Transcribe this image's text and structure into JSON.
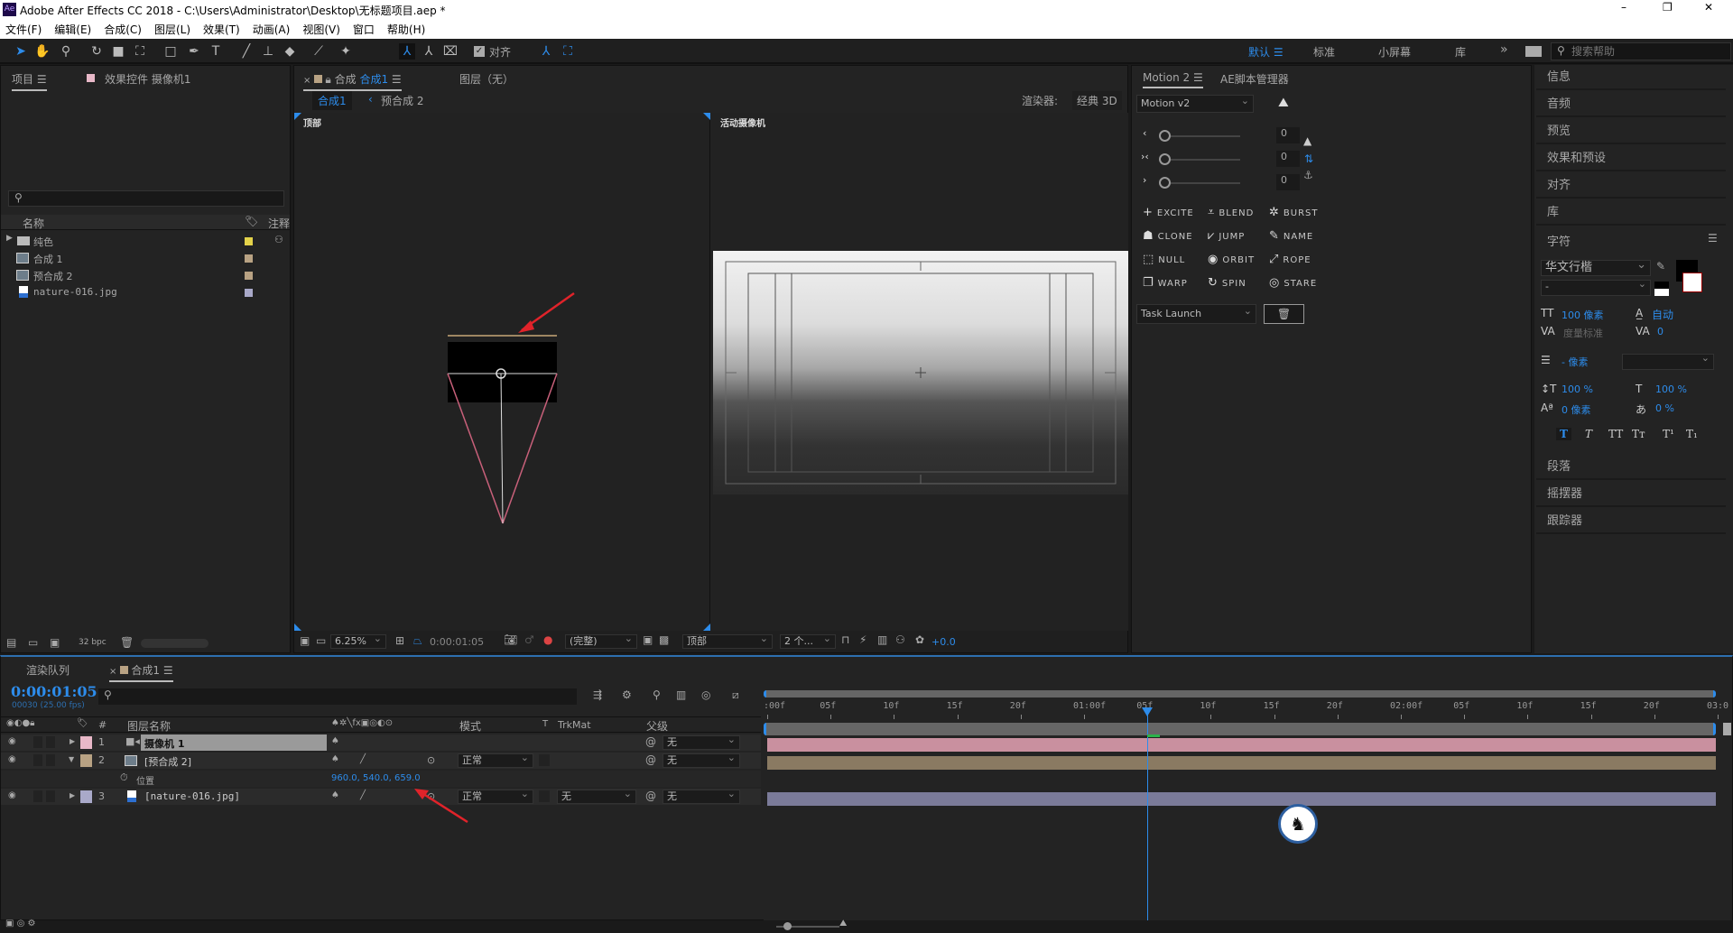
{
  "app": {
    "title": "Adobe After Effects CC 2018 - C:\\Users\\Administrator\\Desktop\\无标题项目.aep *",
    "logo": "Ae"
  },
  "window_controls": {
    "minimize": "–",
    "restore": "❐",
    "close": "✕"
  },
  "menu": [
    "文件(F)",
    "编辑(E)",
    "合成(C)",
    "图层(L)",
    "效果(T)",
    "动画(A)",
    "视图(V)",
    "窗口",
    "帮助(H)"
  ],
  "toolbar": {
    "snap_label": "对齐",
    "workspaces": [
      "默认",
      "标准",
      "小屏幕",
      "库"
    ],
    "more": "»",
    "search_placeholder": "搜索帮助"
  },
  "project": {
    "tab": "项目",
    "effects_tab": "效果控件 摄像机1",
    "search_placeholder": "",
    "col_name": "名称",
    "col_comment": "注释",
    "items": [
      {
        "name": "纯色",
        "type": "folder",
        "color": "#e3d24a"
      },
      {
        "name": "合成 1",
        "type": "comp",
        "color": "#b8a283"
      },
      {
        "name": "预合成 2",
        "type": "comp",
        "color": "#b8a283"
      },
      {
        "name": "nature-016.jpg",
        "type": "image",
        "color": "#a9a9c9"
      }
    ],
    "bpc": "32 bpc"
  },
  "composition": {
    "tab_prefix": "合成",
    "tab_name": "合成1",
    "layer_tab": "图层（无）",
    "breadcrumb": [
      "合成1",
      "预合成 2"
    ],
    "renderer_label": "渲染器:",
    "renderer": "经典 3D",
    "view_left_label": "顶部",
    "view_right_label": "活动摄像机",
    "footer": {
      "zoom": "6.25%",
      "timecode": "0:00:01:05",
      "resolution": "(完整)",
      "view": "顶部",
      "views": "2 个...",
      "exposure": "+0.0"
    }
  },
  "motion": {
    "tab": "Motion 2",
    "tab2": "AE脚本管理器",
    "preset": "Motion v2",
    "sliders": [
      {
        "icon": "‹",
        "value": "0"
      },
      {
        "icon": "›‹",
        "value": "0"
      },
      {
        "icon": "›",
        "value": "0"
      }
    ],
    "buttons": [
      {
        "label": "EXCITE",
        "icon": "+"
      },
      {
        "label": "BLEND",
        "icon": "⩡"
      },
      {
        "label": "BURST",
        "icon": "✲"
      },
      {
        "label": "CLONE",
        "icon": "☗"
      },
      {
        "label": "JUMP",
        "icon": "⩗"
      },
      {
        "label": "NAME",
        "icon": "✎"
      },
      {
        "label": "NULL",
        "icon": "⬚"
      },
      {
        "label": "ORBIT",
        "icon": "◉"
      },
      {
        "label": "ROPE",
        "icon": "⤢"
      },
      {
        "label": "WARP",
        "icon": "❐"
      },
      {
        "label": "SPIN",
        "icon": "↻"
      },
      {
        "label": "STARE",
        "icon": "◎"
      }
    ],
    "task": "Task Launch"
  },
  "right_panels": [
    "信息",
    "音频",
    "预览",
    "效果和预设",
    "对齐",
    "库"
  ],
  "character": {
    "title": "字符",
    "font": "华文行楷",
    "style": "-",
    "size": "100 像素",
    "leading": "自动",
    "kerning": "度量标准",
    "tracking": "0",
    "stroke": "- 像素",
    "vscale": "100 %",
    "hscale": "100 %",
    "baseline": "0 像素",
    "tsume": "0 %",
    "styles": [
      "T",
      "T",
      "TT",
      "Tт",
      "T¹",
      "T₁"
    ]
  },
  "more_panels": [
    "段落",
    "摇摆器",
    "跟踪器"
  ],
  "timeline": {
    "tab_render": "渲染队列",
    "tab_comp": "合成1",
    "timecode": "0:00:01:05",
    "frame_info": "00030 (25.00 fps)",
    "headers": {
      "num": "#",
      "name": "图层名称",
      "mode": "模式",
      "t": "T",
      "trkmat": "TrkMat",
      "parent": "父级"
    },
    "layers": [
      {
        "num": "1",
        "name": "摄像机 1",
        "color": "#e8b8c8",
        "bar": "#c9909f",
        "mode": "",
        "trkmat": "",
        "parent": "无"
      },
      {
        "num": "2",
        "name": "[预合成 2]",
        "color": "#b8a283",
        "bar": "#8a7a62",
        "mode": "正常",
        "trkmat": "",
        "parent": "无"
      },
      {
        "num": "3",
        "name": "[nature-016.jpg]",
        "color": "#a9a9c9",
        "bar": "#7b7b99",
        "mode": "正常",
        "trkmat": "无",
        "parent": "无"
      }
    ],
    "property": {
      "name": "位置",
      "value": "960.0, 540.0, 659.0"
    },
    "ruler": [
      ":00f",
      "05f",
      "10f",
      "15f",
      "20f",
      "01:00f",
      "05f",
      "10f",
      "15f",
      "20f",
      "02:00f",
      "05f",
      "10f",
      "15f",
      "20f",
      "03:0"
    ],
    "playhead_frame": 30,
    "duration_frames": 75
  },
  "colors": {
    "accent": "#2d8ceb",
    "arrow": "#e0232a"
  }
}
